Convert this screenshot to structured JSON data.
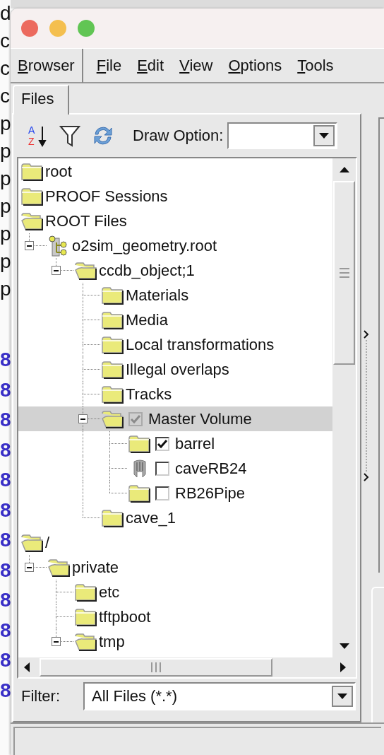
{
  "background_terminal": {
    "top_lines": [
      "d",
      "c",
      "c",
      "c",
      "p",
      "p",
      "p",
      "p",
      "p",
      "p",
      "p"
    ],
    "bottom_lines": [
      "8",
      "8",
      "8",
      "8",
      "8",
      "8",
      "8",
      "8",
      "8",
      "8",
      "8",
      "8"
    ]
  },
  "menu": [
    {
      "label": "Browser",
      "kind": "raised"
    },
    {
      "label": "File",
      "kind": "plain"
    },
    {
      "label": "Edit",
      "kind": "plain"
    },
    {
      "label": "View",
      "kind": "plain"
    },
    {
      "label": "Options",
      "kind": "plain"
    },
    {
      "label": "Tools",
      "kind": "plain"
    }
  ],
  "tabs": [
    {
      "label": "Files",
      "selected": true
    }
  ],
  "toolbar": {
    "sort_letters": [
      "A",
      "Z"
    ],
    "draw_option_label": "Draw Option:"
  },
  "tree": [
    {
      "label": "root",
      "kind": "folder",
      "selected": false
    },
    {
      "label": "PROOF Sessions",
      "kind": "folder",
      "selected": false
    },
    {
      "label": "ROOT Files",
      "kind": "folder",
      "expanded": true,
      "selected": false,
      "children": [
        {
          "label": "o2sim_geometry.root",
          "kind": "file",
          "expanded": true,
          "selected": false,
          "children": [
            {
              "label": "ccdb_object;1",
              "kind": "folder",
              "expanded": true,
              "selected": false,
              "children": [
                {
                  "label": "Materials",
                  "kind": "folder",
                  "selected": false
                },
                {
                  "label": "Media",
                  "kind": "folder",
                  "selected": false
                },
                {
                  "label": "Local transformations",
                  "kind": "folder",
                  "selected": false
                },
                {
                  "label": "Illegal overlaps",
                  "kind": "folder",
                  "selected": false
                },
                {
                  "label": "Tracks",
                  "kind": "folder",
                  "selected": false
                },
                {
                  "label": "Master Volume",
                  "kind": "folder",
                  "expanded": true,
                  "selected": true,
                  "checkbox": {
                    "checked": true,
                    "disabled": true
                  },
                  "children": [
                    {
                      "label": "barrel",
                      "kind": "folder",
                      "selected": false,
                      "checkbox": {
                        "checked": true,
                        "disabled": false
                      }
                    },
                    {
                      "label": "caveRB24",
                      "kind": "volume",
                      "selected": false,
                      "checkbox": {
                        "checked": false,
                        "disabled": false
                      }
                    },
                    {
                      "label": "RB26Pipe",
                      "kind": "folder",
                      "selected": false,
                      "checkbox": {
                        "checked": false,
                        "disabled": false
                      }
                    }
                  ]
                },
                {
                  "label": "cave_1",
                  "kind": "folder",
                  "selected": false
                }
              ]
            }
          ]
        }
      ]
    },
    {
      "label": "/",
      "kind": "folder",
      "expanded": true,
      "selected": false,
      "children": [
        {
          "label": "private",
          "kind": "folder",
          "expanded": true,
          "selected": false,
          "children": [
            {
              "label": "etc",
              "kind": "folder",
              "selected": false
            },
            {
              "label": "tftpboot",
              "kind": "folder",
              "selected": false
            },
            {
              "label": "tmp",
              "kind": "folder",
              "expanded": true,
              "selected": false
            }
          ]
        }
      ]
    }
  ],
  "filter": {
    "label": "Filter:",
    "value": "All Files (*.*)"
  }
}
